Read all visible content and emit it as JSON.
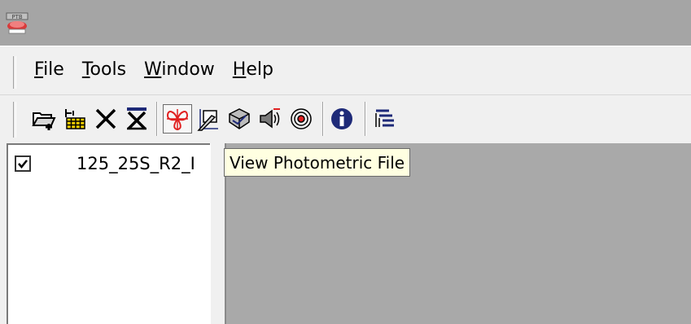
{
  "window": {
    "app_icon": "ptb-app-icon"
  },
  "menu": {
    "file": {
      "mnemonic": "F",
      "rest": "ile"
    },
    "tools": {
      "mnemonic": "T",
      "rest": "ools"
    },
    "window": {
      "mnemonic": "W",
      "rest": "indow"
    },
    "help": {
      "mnemonic": "H",
      "rest": "elp"
    }
  },
  "toolbar": {
    "buttons": [
      {
        "icon": "open-folder-icon"
      },
      {
        "icon": "grid-tool-icon"
      },
      {
        "icon": "close-x-icon"
      },
      {
        "icon": "close-all-icon"
      },
      {
        "icon": "view-photometric-icon",
        "hovered": true
      },
      {
        "icon": "edit-graph-icon"
      },
      {
        "icon": "luminaire-icon"
      },
      {
        "icon": "sound-icon"
      },
      {
        "icon": "target-icon"
      },
      {
        "icon": "info-icon"
      },
      {
        "icon": "cascade-windows-icon"
      }
    ]
  },
  "tree": {
    "items": [
      {
        "label": "125_25S_R2_I",
        "checked": true
      }
    ]
  },
  "tooltip": {
    "text": "View Photometric File"
  },
  "colors": {
    "titlebar": "#a5a5a5",
    "mdi_background": "#a9a9a9",
    "tooltip_bg": "#ffffe1",
    "icon_red": "#e02020",
    "icon_navy": "#1e2a78"
  }
}
